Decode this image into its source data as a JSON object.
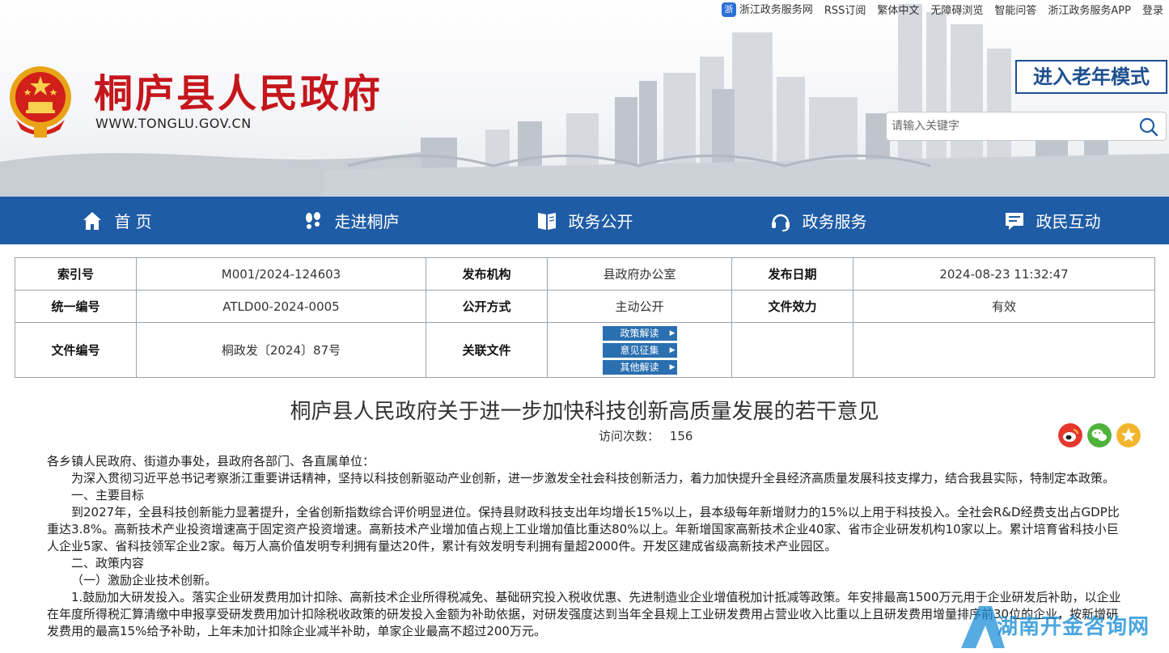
{
  "toplinks": [
    "浙江政务服务网",
    "RSS订阅",
    "繁体中文",
    "无障碍浏览",
    "智能问答",
    "浙江政务服务APP",
    "登录"
  ],
  "header": {
    "site_title": "桐庐县人民政府",
    "site_url": "WWW.TONGLU.GOV.CN",
    "elder_mode": "进入老年模式",
    "search_placeholder": "请输入关键字"
  },
  "nav": [
    {
      "label": "首 页",
      "icon": "home-icon"
    },
    {
      "label": "走进桐庐",
      "icon": "footprints-icon"
    },
    {
      "label": "政务公开",
      "icon": "book-icon"
    },
    {
      "label": "政务服务",
      "icon": "headset-icon"
    },
    {
      "label": "政民互动",
      "icon": "message-icon"
    }
  ],
  "meta": {
    "index_label": "索引号",
    "index_value": "M001/2024-124603",
    "publisher_label": "发布机构",
    "publisher_value": "县政府办公室",
    "date_label": "发布日期",
    "date_value": "2024-08-23 11:32:47",
    "code_label": "统一编号",
    "code_value": "ATLD00-2024-0005",
    "open_label": "公开方式",
    "open_value": "主动公开",
    "validity_label": "文件效力",
    "validity_value": "有效",
    "docno_label": "文件编号",
    "docno_value": "桐政发〔2024〕87号",
    "related_label": "关联文件",
    "related_buttons": [
      "政策解读",
      "意见征集",
      "其他解读"
    ]
  },
  "article": {
    "title": "桐庐县人民政府关于进一步加快科技创新高质量发展的若干意见",
    "visits_label": "访问次数：",
    "visits": "156",
    "paragraphs": [
      "各乡镇人民政府、街道办事处，县政府各部门、各直属单位：",
      "为深入贯彻习近平总书记考察浙江重要讲话精神，坚持以科技创新驱动产业创新，进一步激发全社会科技创新活力，着力加快提升全县经济高质量发展科技支撑力，结合我县实际，特制定本政策。",
      "一、主要目标",
      "到2027年，全县科技创新能力显著提升，全省创新指数综合评价明显进位。保持县财政科技支出年均增长15%以上，县本级每年新增财力的15%以上用于科技投入。全社会R&D经费支出占GDP比重达3.8%。高新技术产业投资增速高于固定资产投资增速。高新技术产业增加值占规上工业增加值比重达80%以上。年新增国家高新技术企业40家、省市企业研发机构10家以上。累计培育省科技小巨人企业5家、省科技领军企业2家。每万人高价值发明专利拥有量达20件，累计有效发明专利拥有量超2000件。开发区建成省级高新技术产业园区。",
      "二、政策内容",
      "（一）激励企业技术创新。",
      "1.鼓励加大研发投入。落实企业研发费用加计扣除、高新技术企业所得税减免、基础研究投入税收优惠、先进制造业企业增值税加计抵减等政策。年安排最高1500万元用于企业研发后补助，以企业在年度所得税汇算清缴中申报享受研发费用加计扣除税收政策的研发投入金额为补助依据，对研发强度达到当年全县规上工业研发费用占营业收入比重以上且研发费用增量排序前30位的企业，按新增研发费用的最高15%给予补助，上年未加计扣除企业减半补助，单家企业最高不超过200万元。"
    ]
  },
  "watermark": "湖南开金咨询网"
}
